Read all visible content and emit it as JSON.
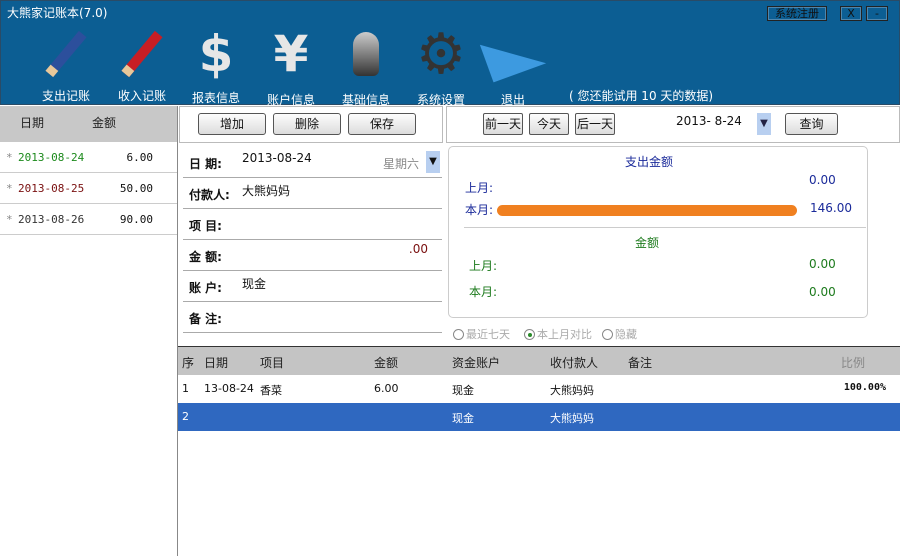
{
  "app": {
    "title": "大熊家记账本(7.0)",
    "register": "系统注册",
    "close": "X",
    "minimize": "-"
  },
  "toolbar": [
    {
      "label": "支出记账",
      "icon": "blue-pencil-icon"
    },
    {
      "label": "收入记账",
      "icon": "red-pencil-icon"
    },
    {
      "label": "报表信息",
      "icon": "dollar-icon"
    },
    {
      "label": "账户信息",
      "icon": "yen-icon"
    },
    {
      "label": "基础信息",
      "icon": "person-icon"
    },
    {
      "label": "系统设置",
      "icon": "gear-icon"
    },
    {
      "label": "退出",
      "icon": "paper-plane-icon"
    }
  ],
  "trial": "( 您还能试用 10 天的数据)",
  "left": {
    "headers": [
      "日期",
      "金额"
    ],
    "rows": [
      {
        "date": "2013-08-24",
        "amount": "6.00",
        "color": "#1c8a1c"
      },
      {
        "date": "2013-08-25",
        "amount": "50.00",
        "color": "#7a1010"
      },
      {
        "date": "2013-08-26",
        "amount": "90.00",
        "color": "#333333"
      }
    ],
    "marker": "*"
  },
  "actions": {
    "add": "增加",
    "delete": "删除",
    "save": "保存"
  },
  "nav": {
    "prev": "前一天",
    "today": "今天",
    "next": "后一天",
    "date": "2013- 8-24",
    "query": "查询"
  },
  "form": {
    "date_label": "日 期:",
    "date": "2013-08-24",
    "weekday": "星期六",
    "payer_label": "付款人:",
    "payer": "大熊妈妈",
    "item_label": "项 目:",
    "amount_label": "金 额:",
    "amount": ".00",
    "account_label": "账 户:",
    "account": "现金",
    "note_label": "备 注:"
  },
  "stats": {
    "expense_title": "支出金额",
    "last_month": "上月:",
    "this_month": "本月:",
    "expense_last": "0.00",
    "expense_this": "146.00",
    "income_title": "金额",
    "income_last": "0.00",
    "income_this": "0.00",
    "bar_color": "#f08020"
  },
  "radios": [
    {
      "label": "最近七天",
      "checked": false
    },
    {
      "label": "本上月对比",
      "checked": true
    },
    {
      "label": "隐藏",
      "checked": false
    }
  ],
  "table": {
    "headers": [
      "序",
      "日期",
      "项目",
      "金额",
      "资金账户",
      "收付款人",
      "备注",
      "比例"
    ],
    "rows": [
      [
        "1",
        "13-08-24",
        "香菜",
        "6.00",
        "现金",
        "大熊妈妈",
        "",
        "100.00%"
      ],
      [
        "2",
        "",
        "",
        "",
        "现金",
        "大熊妈妈",
        "",
        ""
      ]
    ]
  }
}
